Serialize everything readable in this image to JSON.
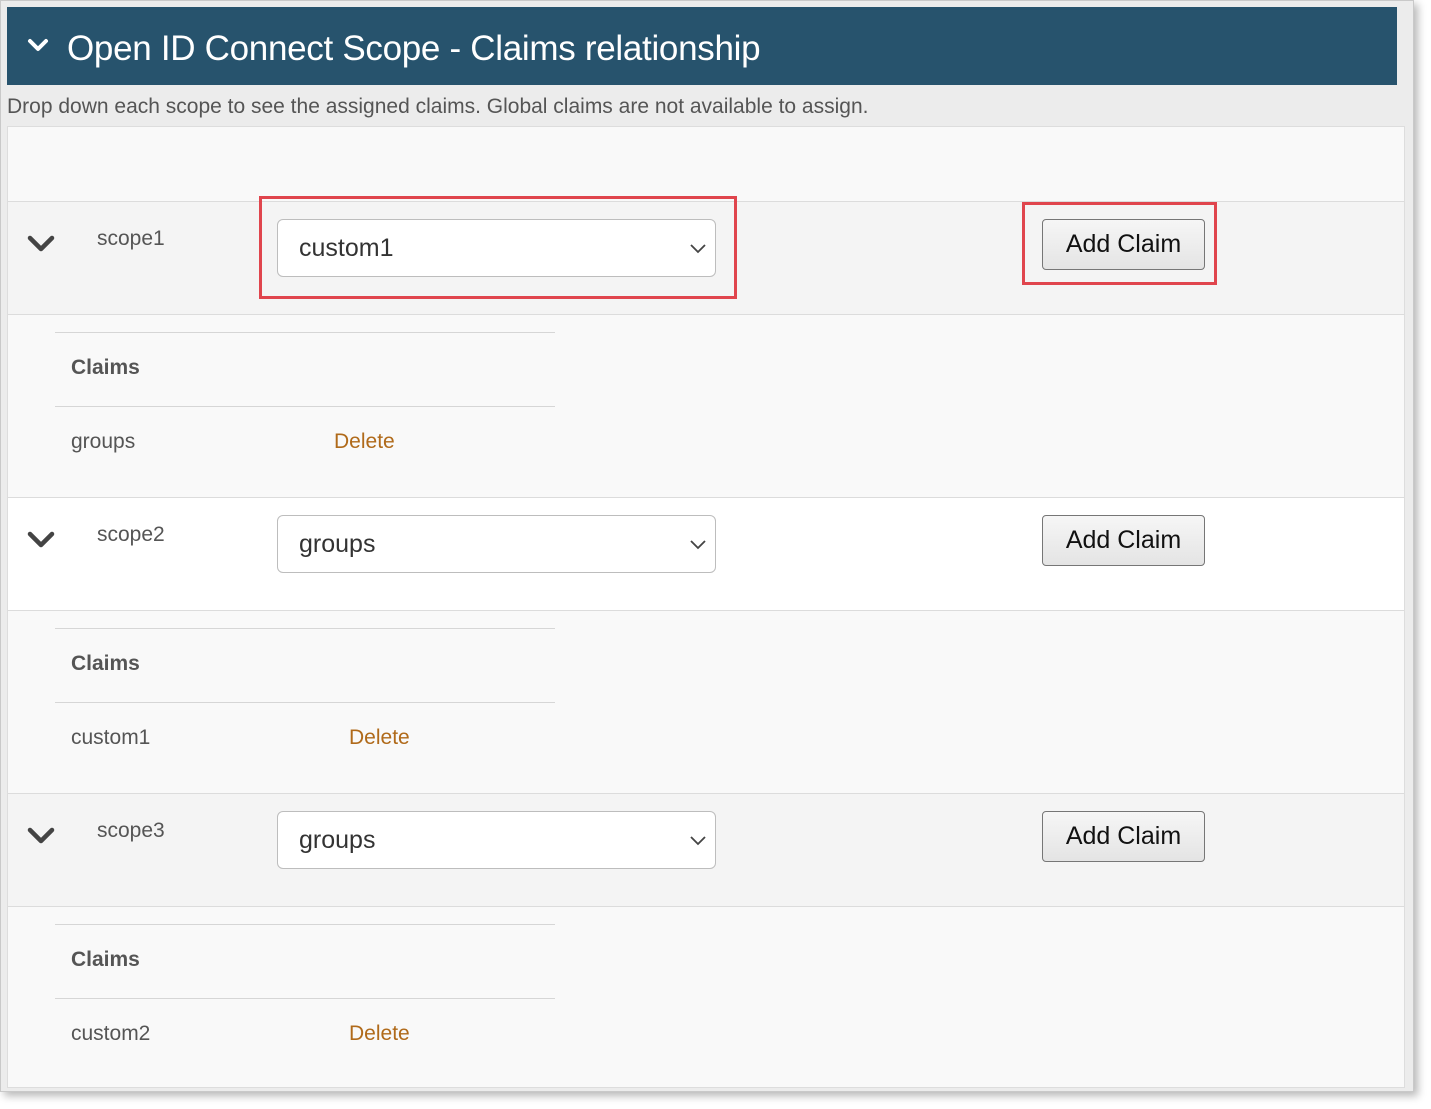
{
  "header": {
    "title": "Open ID Connect Scope - Claims relationship"
  },
  "intro_text": "Drop down each scope to see the assigned claims. Global claims are not available to assign.",
  "colors": {
    "header_bg": "#27536d",
    "delete_link": "#b06a1a",
    "highlight": "#e0454d"
  },
  "scopes": [
    {
      "name": "scope1",
      "selected_claim": "custom1",
      "add_button_label": "Add Claim",
      "claims_header": "Claims",
      "claims": [
        {
          "name": "groups",
          "action": "Delete"
        }
      ]
    },
    {
      "name": "scope2",
      "selected_claim": "groups",
      "add_button_label": "Add Claim",
      "claims_header": "Claims",
      "claims": [
        {
          "name": "custom1",
          "action": "Delete"
        }
      ]
    },
    {
      "name": "scope3",
      "selected_claim": "groups",
      "add_button_label": "Add Claim",
      "claims_header": "Claims",
      "claims": [
        {
          "name": "custom2",
          "action": "Delete"
        }
      ]
    }
  ]
}
